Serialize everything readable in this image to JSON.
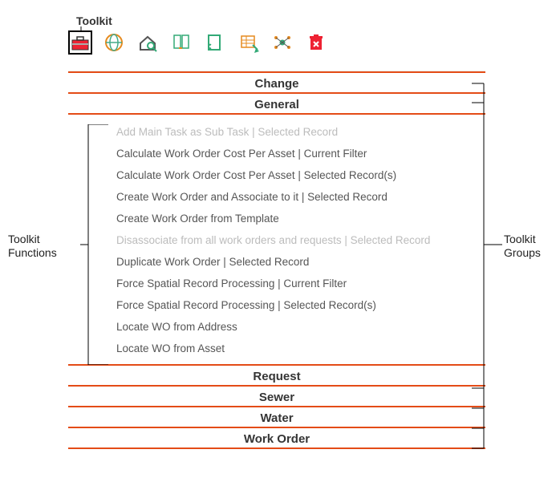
{
  "annotations": {
    "top_label": "Toolkit",
    "functions_label1": "Toolkit",
    "functions_label2": "Functions",
    "groups_label1": "Toolkit",
    "groups_label2": "Groups"
  },
  "toolbar_icons": [
    "toolkit-icon",
    "globe-icon",
    "home-search-icon",
    "documents-icon",
    "form-icon",
    "spreadsheet-icon",
    "network-icon",
    "delete-icon"
  ],
  "panel": {
    "group1": "Change",
    "group2": "General",
    "group3": "Request",
    "group4": "Sewer",
    "group5": "Water",
    "group6": "Work Order",
    "functions": {
      "f0": "Add Main Task as Sub Task | Selected Record",
      "f1": "Calculate Work Order Cost Per Asset | Current Filter",
      "f2": "Calculate Work Order Cost Per Asset | Selected Record(s)",
      "f3": "Create Work Order and Associate to it | Selected Record",
      "f4": "Create Work Order from Template",
      "f5": "Disassociate from all work orders and requests | Selected Record",
      "f6": "Duplicate Work Order | Selected Record",
      "f7": "Force Spatial Record Processing | Current Filter",
      "f8": "Force Spatial Record Processing | Selected Record(s)",
      "f9": "Locate WO from Address",
      "f10": "Locate WO from Asset"
    }
  }
}
